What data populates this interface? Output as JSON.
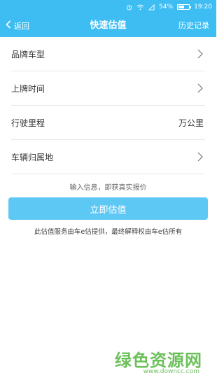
{
  "status_bar": {
    "battery_percent_text": "54%",
    "battery_level": 0.54,
    "time": "19:20",
    "icons": [
      "alarm-icon",
      "wifi-icon",
      "signal-icon",
      "battery-icon"
    ]
  },
  "header": {
    "back_label": "返回",
    "title": "快速估值",
    "history_label": "历史记录",
    "background_color": "#3ebdf3"
  },
  "form": {
    "rows": [
      {
        "label": "品牌车型",
        "trailing": "chevron"
      },
      {
        "label": "上牌时间",
        "trailing": "chevron"
      },
      {
        "label": "行驶里程",
        "trailing": "unit",
        "unit": "万公里"
      },
      {
        "label": "车辆归属地",
        "trailing": "chevron"
      }
    ]
  },
  "hint": "输入信息，即获真实报价",
  "primary_button": {
    "label": "立即估值",
    "color": "#5ec8f5"
  },
  "disclaimer": "此估值服务由车e估提供，最终解释权由车e估所有",
  "watermark": {
    "main": "绿色资源网",
    "sub": "www.downcc.com",
    "color": "#6cc05a"
  }
}
